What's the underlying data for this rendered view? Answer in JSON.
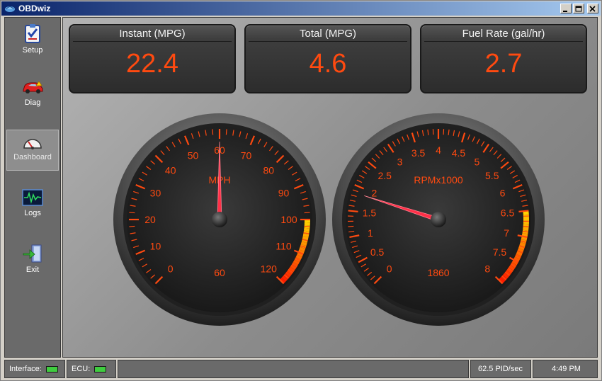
{
  "window": {
    "title": "OBDwiz"
  },
  "sidebar": {
    "items": [
      {
        "label": "Setup",
        "icon": "setup-clipboard-icon"
      },
      {
        "label": "Diag",
        "icon": "car-diag-icon"
      },
      {
        "label": "Dashboard",
        "icon": "dashboard-gauge-icon",
        "active": true
      },
      {
        "label": "Logs",
        "icon": "logs-waveform-icon"
      },
      {
        "label": "Exit",
        "icon": "exit-door-icon"
      }
    ]
  },
  "panels": [
    {
      "title": "Instant (MPG)",
      "value": "22.4"
    },
    {
      "title": "Total (MPG)",
      "value": "4.6"
    },
    {
      "title": "Fuel Rate (gal/hr)",
      "value": "2.7"
    }
  ],
  "gauges": {
    "speed": {
      "unit_label": "MPH",
      "readout": "60",
      "value": 60,
      "min": 0,
      "max": 120,
      "redline_start": 100,
      "ticks": [
        "0",
        "10",
        "20",
        "30",
        "40",
        "50",
        "60",
        "70",
        "80",
        "90",
        "100",
        "110",
        "120"
      ]
    },
    "rpm": {
      "unit_label": "RPMx1000",
      "readout": "1860",
      "value": 1.86,
      "min": 0,
      "max": 8,
      "redline_start": 6.5,
      "ticks": [
        "0",
        "0.5",
        "1",
        "1.5",
        "2",
        "2.5",
        "3",
        "3.5",
        "4",
        "4.5",
        "5",
        "5.5",
        "6",
        "6.5",
        "7",
        "7.5",
        "8"
      ]
    }
  },
  "statusbar": {
    "interface_label": "Interface:",
    "ecu_label": "ECU:",
    "pid_rate": "62.5 PID/sec",
    "time": "4:49 PM"
  },
  "colors": {
    "accent": "#ff4a10",
    "titlebar": "#0a246a",
    "led": "#3fcc3f"
  }
}
